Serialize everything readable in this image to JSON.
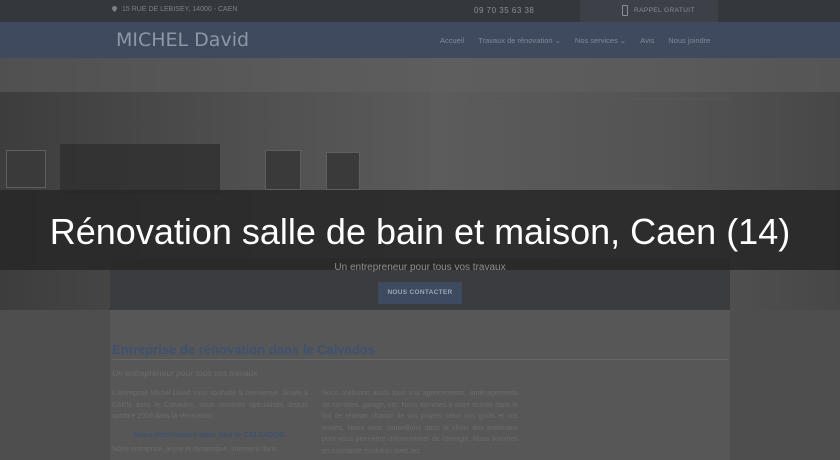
{
  "topbar": {
    "address": "15 RUE DE LEBISEY, 14000 - CAEN",
    "phone": "09 70 35 63 38",
    "callback_label": "RAPPEL GRATUIT"
  },
  "navbar": {
    "brand": "MICHEL David",
    "items": [
      {
        "label": "Accueil"
      },
      {
        "label": "Travaux de rénovation ⌄"
      },
      {
        "label": "Nos services ⌄"
      },
      {
        "label": "Avis"
      },
      {
        "label": "Nous joindre"
      }
    ]
  },
  "hero": {
    "title": "Rénovation salle de bain et maison, Caen (14)",
    "tagline": "Un entrepreneur pour tous vos travaux",
    "cta_label": "NOUS CONTACTER"
  },
  "content": {
    "section_title": "Entreprise de rénovation dans le Calvados",
    "section_subtitle": "Un entrepreneur pour tous vos travaux",
    "left_col": {
      "p1": "L'entreprise Michel David vous souhaite la bienvenue. Située à CAEN dans le Calvados, nous sommes spécialisés depuis octobre 2009 dans la rénovation.",
      "sub_heading": "Nous intervenons dans tout le CALVADOS.",
      "p2": "Notre entreprise, jeune et dynamique, intervient dans"
    },
    "right_col": {
      "p1": "Nous réalisons aussi tous vos agencements, aménagements de combles, garage, etc. Nous sommes à votre écoute dans le but de réaliser chacun de vos projets selon vos goûts et vos envies. Nous vous conseillons dans le choix des matériaux pour vous permettre d'économiser de l'énergie. Nous sommes en constante évolution avec les"
    }
  },
  "colors": {
    "nav_bg": "#3f4a5e",
    "overlay": "#282828",
    "section_title": "#3d5170"
  }
}
